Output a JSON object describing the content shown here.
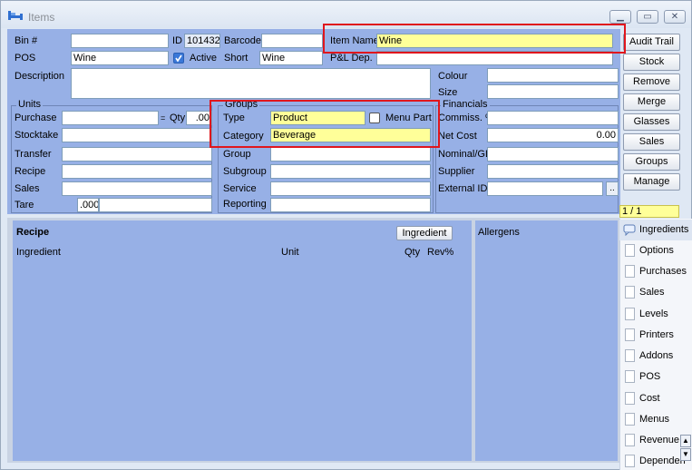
{
  "window": {
    "title": "Items"
  },
  "top": {
    "bin_label": "Bin #",
    "bin_value": "",
    "id_label": "ID",
    "id_value": "101432",
    "barcode_label": "Barcode",
    "barcode_value": "",
    "item_name_label": "Item Name",
    "item_name_value": "Wine",
    "pos_label": "POS",
    "pos_value": "Wine",
    "active_label": "Active",
    "active_checked": true,
    "short_label": "Short",
    "short_value": "Wine",
    "pl_dep_label": "P&L Dep.",
    "pl_dep_value": "",
    "description_label": "Description",
    "description_value": "",
    "colour_label": "Colour",
    "colour_value": "",
    "size_label": "Size",
    "size_value": ""
  },
  "units": {
    "title": "Units",
    "purchase_label": "Purchase",
    "purchase_value": "",
    "qty_label": "Qty",
    "qty_value": ".00",
    "stocktake_label": "Stocktake",
    "transfer_label": "Transfer",
    "recipe_label": "Recipe",
    "sales_label": "Sales",
    "tare_label": "Tare",
    "tare_value": ".000"
  },
  "groups": {
    "title": "Groups",
    "type_label": "Type",
    "type_value": "Product",
    "menu_part_label": "Menu Part",
    "menu_part_checked": false,
    "category_label": "Category",
    "category_value": "Beverage",
    "group_label": "Group",
    "subgroup_label": "Subgroup",
    "service_label": "Service",
    "reporting_label": "Reporting"
  },
  "financials": {
    "title": "Financials",
    "commiss_label": "Commiss. %",
    "commiss_value": "",
    "net_cost_label": "Net Cost",
    "net_cost_value": "0.00",
    "nominal_label": "Nominal/GL",
    "supplier_label": "Supplier",
    "external_id_label": "External ID",
    "external_id_button": ".."
  },
  "buttons": [
    "Audit Trail",
    "Stock",
    "Remove",
    "Merge",
    "Glasses",
    "Sales",
    "Groups",
    "Manage"
  ],
  "pager": "1 / 1",
  "recipe": {
    "title": "Recipe",
    "ingredient_button": "Ingredient",
    "col_ingredient": "Ingredient",
    "col_unit": "Unit",
    "col_qty": "Qty",
    "col_rev": "Rev%"
  },
  "allergens": {
    "title": "Allergens"
  },
  "side_tabs": [
    "Ingredients",
    "Options",
    "Purchases",
    "Sales",
    "Levels",
    "Printers",
    "Addons",
    "POS",
    "Cost",
    "Menus",
    "Revenue",
    "Dependen"
  ],
  "colors": {
    "panel": "#97b0e6",
    "highlight_field": "#ffff99",
    "annotation_box": "#e0161d",
    "chrome": "#dfe8f4"
  }
}
